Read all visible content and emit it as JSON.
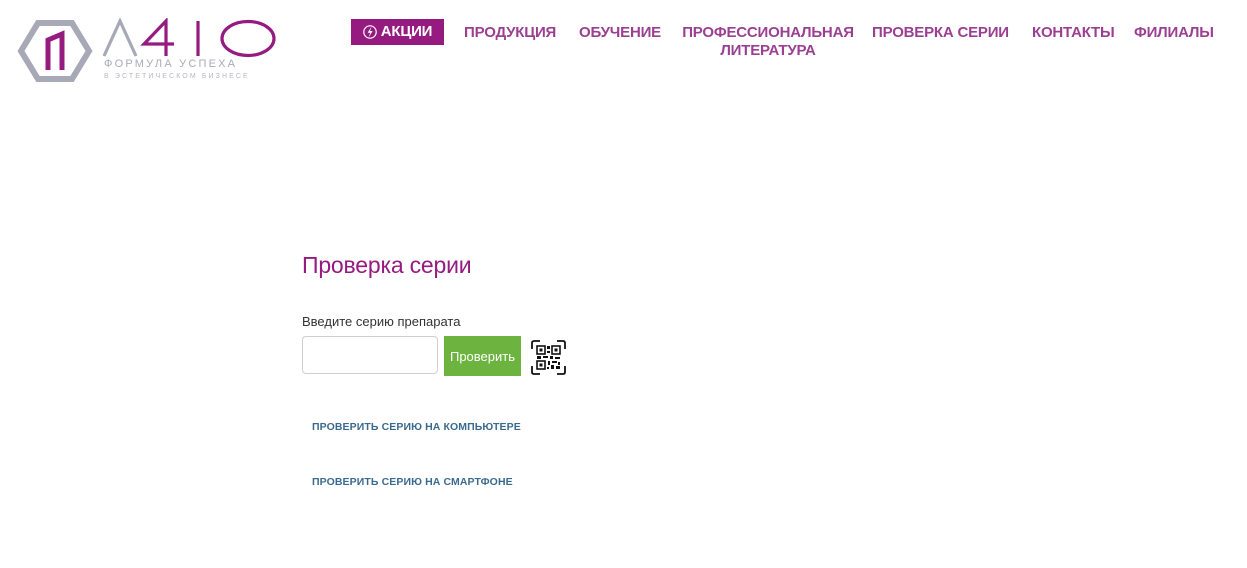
{
  "brand": {
    "name": "A410",
    "tagline": "ФОРМУЛА УСПЕХА",
    "subtagline": "В ЭСТЕТИЧЕСКОМ БИЗНЕСЕ",
    "colors": {
      "purple": "#951b81",
      "gray": "#a7a9b6"
    }
  },
  "nav": {
    "promo": {
      "label": "АКЦИИ",
      "icon": "lightning-icon"
    },
    "items": [
      {
        "label": "ПРОДУКЦИЯ"
      },
      {
        "label": "ОБУЧЕНИЕ"
      },
      {
        "label": "ПРОФЕССИОНАЛЬНАЯ ЛИТЕРАТУРА"
      },
      {
        "label": "ПРОВЕРКА СЕРИИ"
      },
      {
        "label": "КОНТАКТЫ"
      },
      {
        "label": "ФИЛИАЛЫ"
      }
    ]
  },
  "main": {
    "title": "Проверка серии",
    "input_label": "Введите серию препарата",
    "input_value": "",
    "input_placeholder": "",
    "check_button": "Проверить",
    "qr_icon": "qr-code-icon",
    "links": [
      "ПРОВЕРИТЬ СЕРИЮ НА КОМПЬЮТЕРЕ",
      "ПРОВЕРИТЬ СЕРИЮ НА СМАРТФОНЕ"
    ],
    "colors": {
      "accent": "#951b81",
      "button": "#6db33f",
      "link": "#3a6b8f"
    }
  }
}
